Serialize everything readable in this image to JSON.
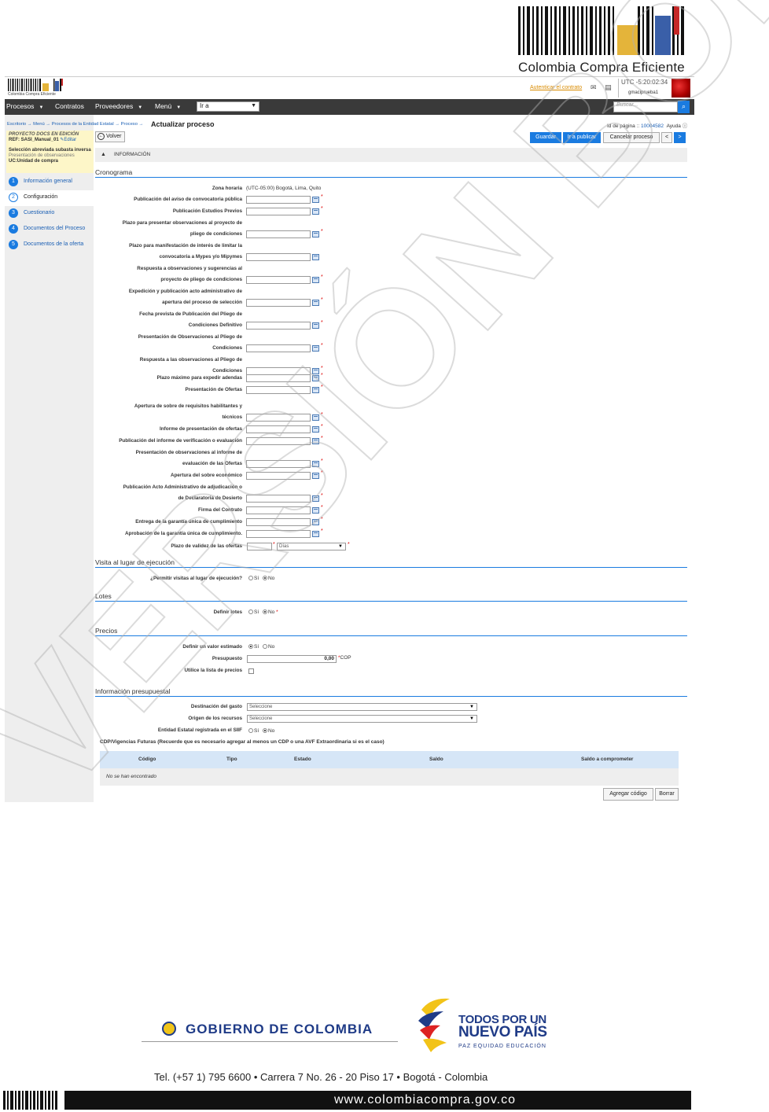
{
  "document": {
    "brand_name": "Colombia Compra Eficiente",
    "footer": {
      "gobierno": "GOBIERNO DE COLOMBIA",
      "slogan_line1": "TODOS POR UN",
      "slogan_line2": "NUEVO PAÍS",
      "slogan_line3": "PAZ  EQUIDAD  EDUCACIÓN",
      "contact": "Tel. (+57 1) 795 6600 • Carrera 7 No. 26 - 20 Piso 17 • Bogotá - Colombia",
      "website": "www.colombiacompra.gov.co"
    },
    "watermark_text": "VERSIÓN BORRADOR"
  },
  "app": {
    "logo_caption": "Colombia Compra Eficiente",
    "auth_link": "Autenticar el contrato",
    "utc": "UTC -5:20:02:34",
    "user": "gmaciprueba1",
    "nav": {
      "procesos": "Procesos",
      "contratos": "Contratos",
      "proveedores": "Proveedores",
      "menu": "Menú",
      "goto": "Ir a",
      "search_placeholder": "Buscar..."
    },
    "breadcrumb": "Escritorio  →  Menú  →  Procesos de la Entidad Estatal  →  Proceso  →",
    "page_title": "Actualizar proceso",
    "page_id_label": "Id de página ::",
    "page_id": "10004582",
    "help": "Ayuda",
    "project": {
      "status": "PROYECTO DOCS EN EDICIÓN",
      "ref": "REF: SASI_Manual_01",
      "edit": "Editar",
      "modality": "Selección abreviada subasta inversa",
      "stage": "Presentación de observaciones",
      "unit": "UC:Unidad de compra"
    },
    "steps": [
      {
        "num": "1",
        "label": "Información general"
      },
      {
        "num": "2",
        "label": "Configuración"
      },
      {
        "num": "3",
        "label": "Cuestionario"
      },
      {
        "num": "4",
        "label": "Documentos del Proceso"
      },
      {
        "num": "5",
        "label": "Documentos de la oferta"
      }
    ],
    "buttons": {
      "back": "Volver",
      "save": "Guardar",
      "publish": "Ir a publicar",
      "cancel": "Cancelar proceso",
      "prev": "<",
      "next": ">",
      "add_code": "Agregar código",
      "delete": "Borrar"
    },
    "info_bar": "INFORMACIÓN",
    "sections": {
      "cronograma": "Cronograma",
      "visita": "Visita al lugar de ejecución",
      "lotes": "Lotes",
      "precios": "Precios",
      "presupuestal": "Información presupuestal"
    },
    "timezone_label": "Zona horaria",
    "timezone_value": "(UTC-05:00) Bogotá, Lima, Quito",
    "schedule": [
      {
        "l1": "Publicación del aviso de convocatoria pública",
        "l2": ""
      },
      {
        "l1": "Publicación Estudios Previos",
        "l2": ""
      },
      {
        "l1": "Plazo para presentar observaciones al proyecto de",
        "l2": "pliego de condiciones"
      },
      {
        "l1": "Plazo para manifestación de interés de limitar la",
        "l2": "convocatoria a Mypes y/o Mipymes"
      },
      {
        "l1": "Respuesta a observaciones y sugerencias al",
        "l2": "proyecto de pliego de condiciones"
      },
      {
        "l1": "Expedición y publicación acto administrativo de",
        "l2": "apertura del proceso de selección"
      },
      {
        "l1": "Fecha prevista de Publicación del Pliego de",
        "l2": "Condiciones Definitivo"
      },
      {
        "l1": "Presentación de Observaciones al Pliego de",
        "l2": "Condiciones"
      },
      {
        "l1": "Respuesta a las observaciones al Pliego de",
        "l2": "Condiciones"
      },
      {
        "l1": "Plazo máximo para expedir adendas",
        "l2": ""
      },
      {
        "l1": "Presentación de Ofertas",
        "l2": ""
      },
      {
        "l1": "Apertura de sobre de requisitos habilitantes y",
        "l2": "técnicos"
      },
      {
        "l1": "Informe de presentación de ofertas",
        "l2": ""
      },
      {
        "l1": "Publicación del informe de verificación o evaluación",
        "l2": ""
      },
      {
        "l1": "Presentación de observaciones al informe de",
        "l2": "evaluación de las Ofertas"
      },
      {
        "l1": "Apertura del sobre económico",
        "l2": ""
      },
      {
        "l1": "Publicación Acto Administrativo de adjudicación o",
        "l2": "de Declaratoria de Desierto"
      },
      {
        "l1": "Firma del Contrato",
        "l2": ""
      },
      {
        "l1": "Entrega de la garantía única de cumplimiento",
        "l2": ""
      },
      {
        "l1": "Aprobación de la garantía única de cumplimiento.",
        "l2": ""
      }
    ],
    "validity_label": "Plazo de validez de las ofertas",
    "validity_unit": "Días",
    "visits_label": "¿Permitir visitas al lugar de ejecución?",
    "lots_label": "Definir lotes",
    "yes": "Sí",
    "no": "No",
    "estimate_label": "Definir un valor estimado",
    "budget_label": "Presupuesto",
    "budget_value": "0,00",
    "currency": "COP",
    "price_list_label": "Utilice la lista de precios",
    "destino_label": "Destinación del gasto",
    "origen_label": "Origen de los recursos",
    "select_placeholder": "Seleccione",
    "siif_label": "Entidad Estatal registrada en el SIIF",
    "cdp_title": "CDP/Vigencias Futuras (Recuerde que es necesario agregar al menos un CDP o una AVF Extraordinaria si es el caso)",
    "table": {
      "headers": [
        "Código",
        "Tipo",
        "Estado",
        "Saldo",
        "Saldo a comprometer"
      ],
      "empty": "No se han encontrado"
    }
  }
}
